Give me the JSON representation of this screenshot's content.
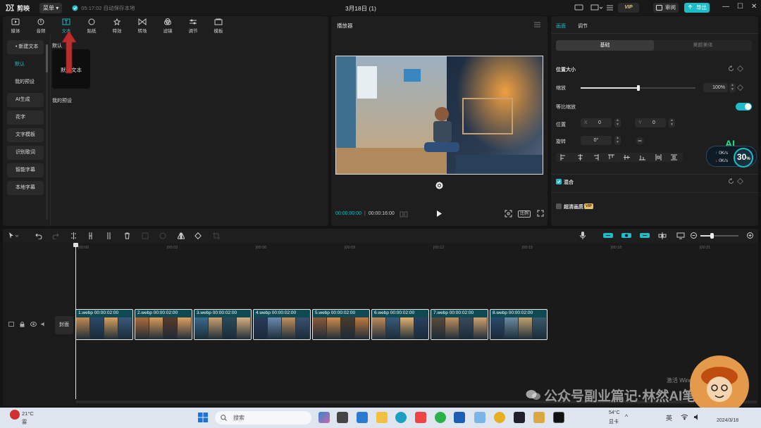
{
  "app": {
    "name": "剪映",
    "menu_label": "菜单",
    "autosave_text": "05:17:02 自动保存本地",
    "title": "3月18日 (1)",
    "vip_label": "VIP",
    "review_label": "审阅",
    "export_label": "导出"
  },
  "tool_tabs": [
    {
      "label": "媒体",
      "icon": "media-icon"
    },
    {
      "label": "音频",
      "icon": "audio-icon"
    },
    {
      "label": "文本",
      "icon": "text-icon",
      "active": true
    },
    {
      "label": "贴纸",
      "icon": "sticker-icon"
    },
    {
      "label": "特效",
      "icon": "effects-icon"
    },
    {
      "label": "转场",
      "icon": "transition-icon"
    },
    {
      "label": "滤镜",
      "icon": "filter-icon"
    },
    {
      "label": "调节",
      "icon": "adjust-icon"
    },
    {
      "label": "模板",
      "icon": "template-icon"
    }
  ],
  "side_nav": [
    {
      "label": "• 新建文本",
      "style": "btn"
    },
    {
      "label": "默认",
      "style": "sel"
    },
    {
      "label": "我的预设",
      "style": "plain"
    },
    {
      "label": "AI生成",
      "style": "btn"
    },
    {
      "label": "花字",
      "style": "btn"
    },
    {
      "label": "文字模板",
      "style": "btn"
    },
    {
      "label": "识别歌词",
      "style": "btn"
    },
    {
      "label": "智能字幕",
      "style": "btn"
    },
    {
      "label": "本地字幕",
      "style": "btn"
    }
  ],
  "text_content": {
    "section_default": "默认",
    "card_label": "默认文本",
    "section_presets": "我的预设"
  },
  "player": {
    "title": "播放器",
    "current_time": "00:00:00:00",
    "total_time": "00:00:16:00",
    "ratio_label": "比例"
  },
  "props": {
    "tab_picture": "画面",
    "tab_adjust": "调节",
    "subtab_basic": "基础",
    "subtab_beauty": "美颜美体",
    "position_size": "位置大小",
    "scale_label": "缩放",
    "scale_value": "100%",
    "scale_fraction": 0.5,
    "uniform_scale_label": "等比缩放",
    "uniform_scale_on": true,
    "position_label": "位置",
    "x_label": "X",
    "x_value": "0",
    "y_label": "Y",
    "y_value": "0",
    "rotation_label": "旋转",
    "rotation_value": "0°",
    "blend_label": "混合",
    "hd_label": "超清画质",
    "hd_badge": "VIP",
    "ai_label": "AI",
    "net_up": "0K/s",
    "net_down": "0K/s",
    "cpu_percent": "30",
    "percent_sign": "%"
  },
  "timeline": {
    "ruler_ticks": [
      "00:00",
      "00:03",
      "00:06",
      "00:09",
      "00:12",
      "00:15",
      "00:18",
      "00:21"
    ],
    "cover_label": "封面",
    "clips": [
      {
        "name": "1.webp",
        "duration": "00:00:02:00"
      },
      {
        "name": "2.webp",
        "duration": "00:00:02:00"
      },
      {
        "name": "3.webp",
        "duration": "00:00:02:00"
      },
      {
        "name": "4.webp",
        "duration": "00:00:02:00"
      },
      {
        "name": "5.webp",
        "duration": "00:00:02:00"
      },
      {
        "name": "6.webp",
        "duration": "00:00:02:00"
      },
      {
        "name": "7.webp",
        "duration": "00:00:02:00"
      },
      {
        "name": "8.webp",
        "duration": "00:00:02:00"
      }
    ]
  },
  "watermark": {
    "activate_windows": "激活 Windows",
    "account_text": "公众号副业篇记·林然AI笔记"
  },
  "taskbar": {
    "weather_temp": "21°C",
    "weather_desc": "雾",
    "search_placeholder": "搜索",
    "temp2": "54°C",
    "temp2_desc": "显卡",
    "ime": "英",
    "date": "2024/3/18"
  },
  "colors": {
    "accent": "#1fbcc7",
    "arrow": "#c83030"
  }
}
